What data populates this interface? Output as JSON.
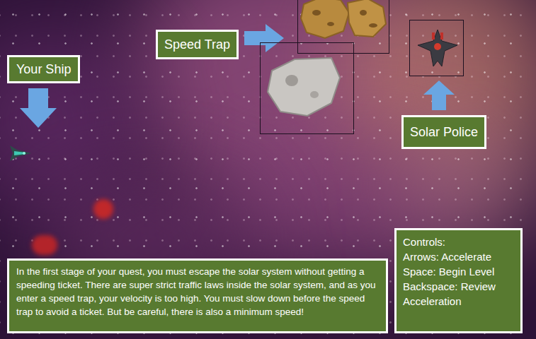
{
  "labels": {
    "your_ship": "Your Ship",
    "speed_trap": "Speed Trap",
    "solar_police": "Solar Police"
  },
  "instructions": "In the first stage of your quest, you must escape the solar system without getting a speeding ticket. There are super strict traffic laws inside the solar system, and as you enter a speed trap, your velocity is too high. You must slow down before the speed trap to avoid a ticket. But be careful, there is also a minimum speed!",
  "controls": {
    "title": "Controls:",
    "items": [
      "Arrows: Accelerate",
      "Space: Begin Level",
      "Backspace: Review Acceleration"
    ]
  }
}
